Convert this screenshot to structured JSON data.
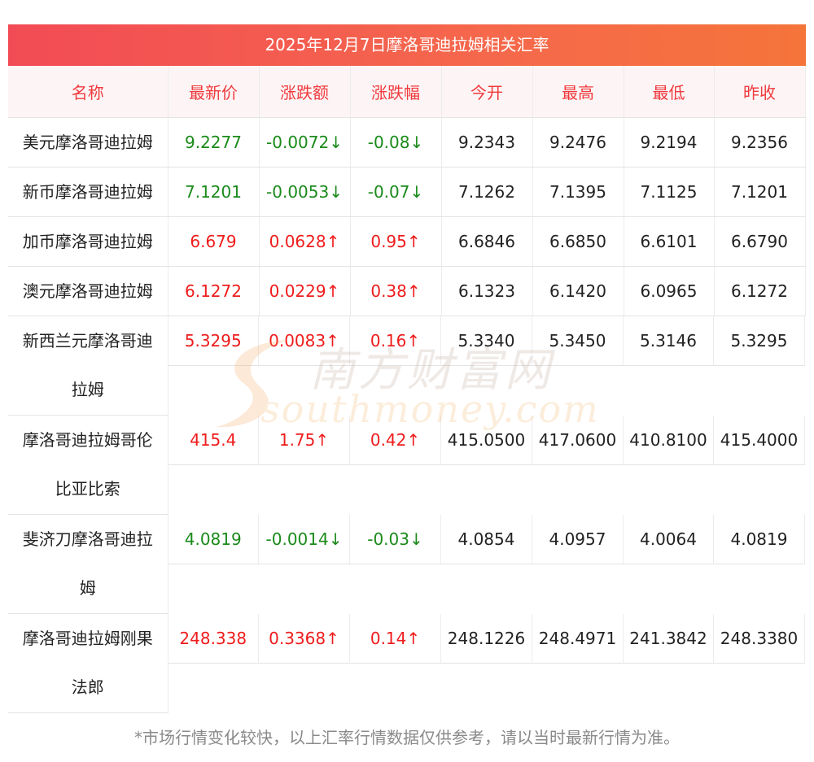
{
  "title": "2025年12月7日摩洛哥迪拉姆相关汇率",
  "columns": [
    "名称",
    "最新价",
    "涨跌额",
    "涨跌幅",
    "今开",
    "最高",
    "最低",
    "昨收"
  ],
  "rows": [
    {
      "name": "美元摩洛哥迪拉姆",
      "name2": "",
      "latest": "9.2277",
      "change": "-0.0072↓",
      "pct": "-0.08↓",
      "open": "9.2343",
      "high": "9.2476",
      "low": "9.2194",
      "prev": "9.2356",
      "dir": "down"
    },
    {
      "name": "新币摩洛哥迪拉姆",
      "name2": "",
      "latest": "7.1201",
      "change": "-0.0053↓",
      "pct": "-0.07↓",
      "open": "7.1262",
      "high": "7.1395",
      "low": "7.1125",
      "prev": "7.1201",
      "dir": "down"
    },
    {
      "name": "加币摩洛哥迪拉姆",
      "name2": "",
      "latest": "6.679",
      "change": "0.0628↑",
      "pct": "0.95↑",
      "open": "6.6846",
      "high": "6.6850",
      "low": "6.6101",
      "prev": "6.6790",
      "dir": "up"
    },
    {
      "name": "澳元摩洛哥迪拉姆",
      "name2": "",
      "latest": "6.1272",
      "change": "0.0229↑",
      "pct": "0.38↑",
      "open": "6.1323",
      "high": "6.1420",
      "low": "6.0965",
      "prev": "6.1272",
      "dir": "up"
    },
    {
      "name": "新西兰元摩洛哥迪",
      "name2": "拉姆",
      "latest": "5.3295",
      "change": "0.0083↑",
      "pct": "0.16↑",
      "open": "5.3340",
      "high": "5.3450",
      "low": "5.3146",
      "prev": "5.3295",
      "dir": "up"
    },
    {
      "name": "摩洛哥迪拉姆哥伦",
      "name2": "比亚比索",
      "latest": "415.4",
      "change": "1.75↑",
      "pct": "0.42↑",
      "open": "415.0500",
      "high": "417.0600",
      "low": "410.8100",
      "prev": "415.4000",
      "dir": "up"
    },
    {
      "name": "斐济刀摩洛哥迪拉",
      "name2": "姆",
      "latest": "4.0819",
      "change": "-0.0014↓",
      "pct": "-0.03↓",
      "open": "4.0854",
      "high": "4.0957",
      "low": "4.0064",
      "prev": "4.0819",
      "dir": "down"
    },
    {
      "name": "摩洛哥迪拉姆刚果",
      "name2": "法郎",
      "latest": "248.338",
      "change": "0.3368↑",
      "pct": "0.14↑",
      "open": "248.1226",
      "high": "248.4971",
      "low": "241.3842",
      "prev": "248.3380",
      "dir": "up"
    }
  ],
  "watermark": {
    "cn": "南方财富网",
    "en": "southmoney.com"
  },
  "footnote": "*市场行情变化较快，以上汇率行情数据仅供参考，请以当时最新行情为准。",
  "colors": {
    "up": "#ef1c1c",
    "down": "#1a8a1a",
    "header_text": "#ef3a3e",
    "banner_start": "#f24b55",
    "banner_end": "#f5743a"
  }
}
